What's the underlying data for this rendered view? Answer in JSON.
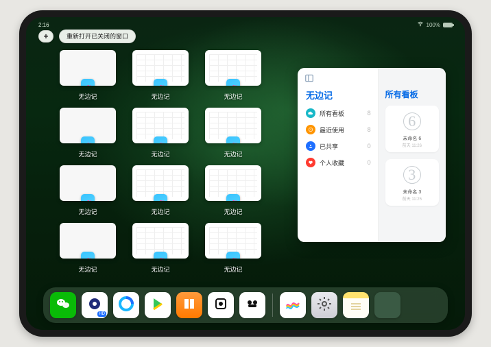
{
  "status": {
    "time": "2:16",
    "battery_pct": "100%"
  },
  "topbar": {
    "plus": "+",
    "reopen_label": "重新打开已关闭的窗口"
  },
  "windows": {
    "app_label": "无边记",
    "tiles": [
      {
        "kind": "blank"
      },
      {
        "kind": "cal"
      },
      {
        "kind": "cal"
      },
      {
        "kind": "blank"
      },
      {
        "kind": "cal"
      },
      {
        "kind": "cal"
      },
      {
        "kind": "blank"
      },
      {
        "kind": "cal"
      },
      {
        "kind": "cal"
      },
      {
        "kind": "blank"
      },
      {
        "kind": "cal"
      },
      {
        "kind": "cal"
      }
    ]
  },
  "preview": {
    "ellipsis": "⋯",
    "title_left": "无边记",
    "title_right": "所有看板",
    "items": [
      {
        "icon": "cloud",
        "color": "#19b8c8",
        "label": "所有看板",
        "count": "8"
      },
      {
        "icon": "clock",
        "color": "#ff9500",
        "label": "最近使用",
        "count": "8"
      },
      {
        "icon": "person",
        "color": "#1e6fff",
        "label": "已共享",
        "count": "0"
      },
      {
        "icon": "heart",
        "color": "#ff3b30",
        "label": "个人收藏",
        "count": "0"
      }
    ],
    "boards": [
      {
        "glyph": "6",
        "title": "未命名 6",
        "subtitle": "前天 11:26"
      },
      {
        "glyph": "3",
        "title": "未命名 3",
        "subtitle": "前天 11:25"
      }
    ]
  },
  "dock": {
    "items": [
      {
        "name": "wechat",
        "cls": "di-wechat"
      },
      {
        "name": "quark",
        "cls": "di-quark",
        "badge": "HD"
      },
      {
        "name": "qqbrowser",
        "cls": "di-qq"
      },
      {
        "name": "play",
        "cls": "di-play"
      },
      {
        "name": "books",
        "cls": "di-books"
      },
      {
        "name": "dice",
        "cls": "di-dice"
      },
      {
        "name": "game",
        "cls": "di-game"
      },
      {
        "name": "sep"
      },
      {
        "name": "freeform",
        "cls": "di-freeform"
      },
      {
        "name": "settings",
        "cls": "di-settings"
      },
      {
        "name": "notes",
        "cls": "di-notes"
      },
      {
        "name": "folder",
        "cls": "di-folder"
      }
    ]
  }
}
